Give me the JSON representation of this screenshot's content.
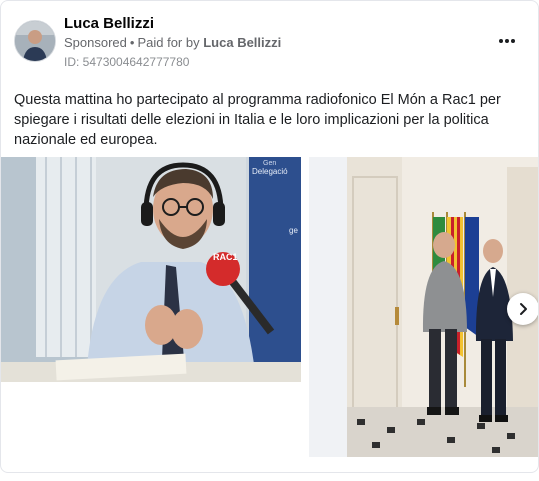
{
  "post": {
    "author": "Luca Bellizzi",
    "sponsored_label": "Sponsored",
    "separator": "•",
    "paid_for_label": "Paid for by",
    "payer": "Luca Bellizzi",
    "ad_id": "ID: 5473004642777780",
    "text": "Questa mattina ho partecipato al programma radiofonico El Món a Rac1 per spiegare i risultati delle elezioni in Italia e le loro implicazioni per la politica nazionale ed europea."
  },
  "media": {
    "slide1_banner": "Delegació",
    "slide1_banner_top": "Gen",
    "slide1_banner_small": "ge",
    "mic_logo": "RAC1"
  },
  "icons": {
    "more": "more-horizontal-icon",
    "next": "chevron-right-icon"
  },
  "colors": {
    "text_primary": "#050505",
    "text_secondary": "#65676b",
    "border": "#e4e6eb"
  }
}
